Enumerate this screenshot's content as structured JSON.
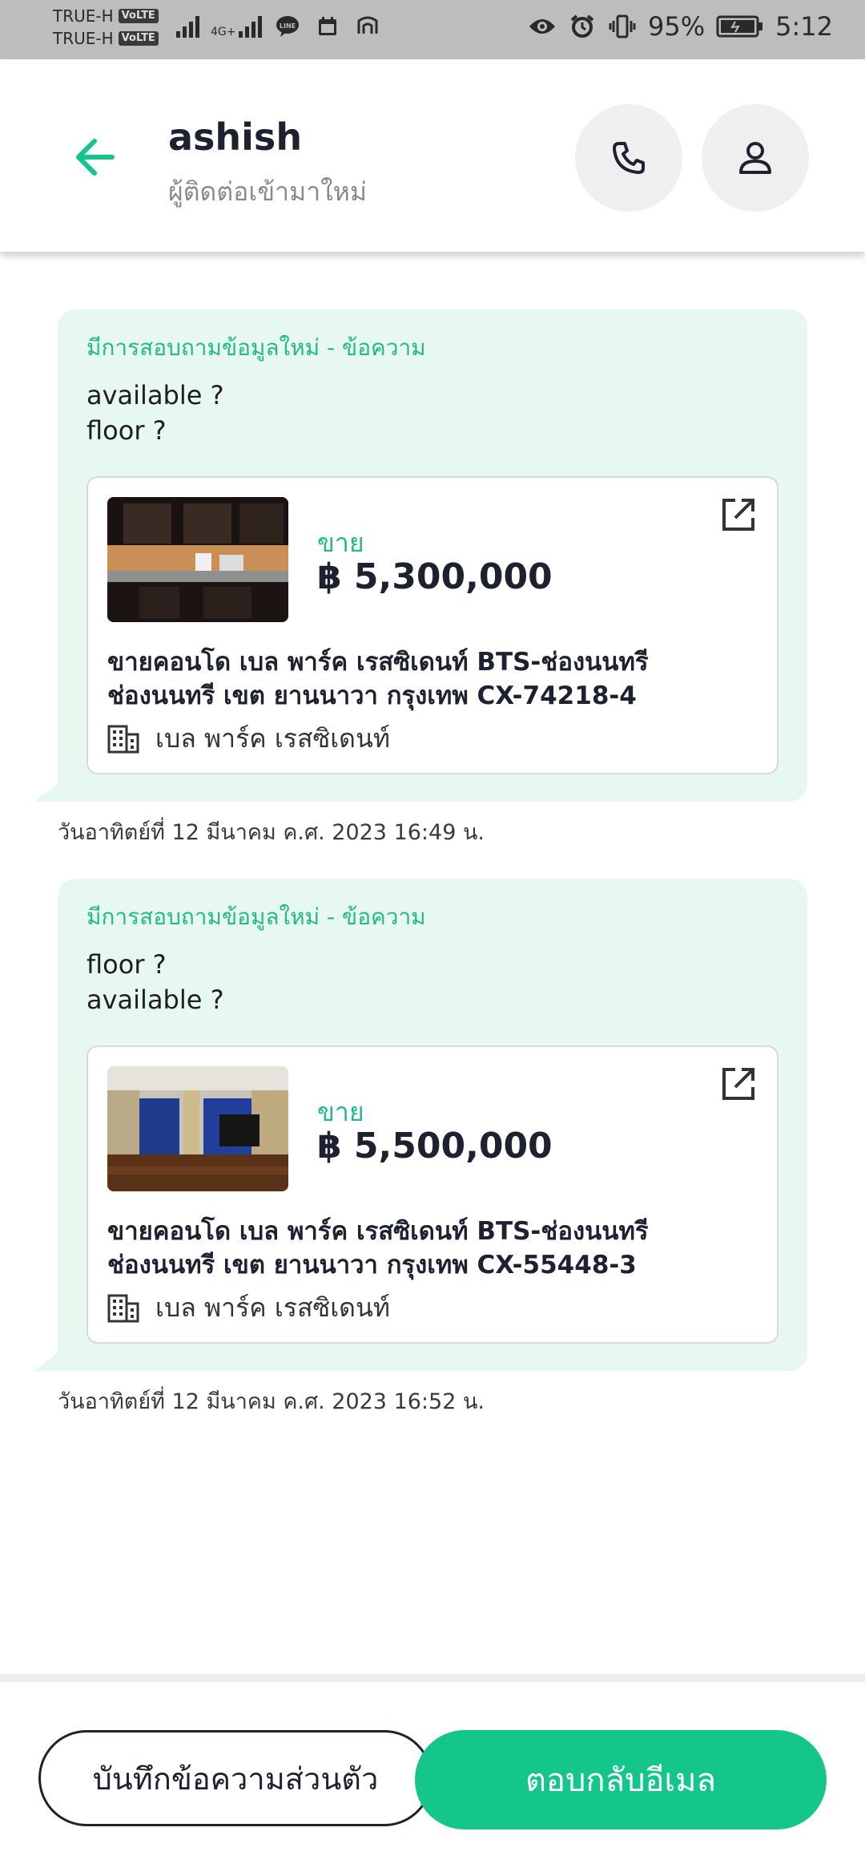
{
  "status_bar": {
    "carrier1": "TRUE-H",
    "carrier2": "TRUE-H",
    "volte": "VoLTE",
    "network": "4G+",
    "battery": "95%",
    "time": "5:12"
  },
  "header": {
    "name": "ashish",
    "subtitle": "ผู้ติดต่อเข้ามาใหม่"
  },
  "messages": [
    {
      "label": "มีการสอบถามข้อมูลใหม่ - ข้อความ",
      "lines": [
        "available ?",
        "floor ?"
      ],
      "listing": {
        "type": "ขาย",
        "price": "฿ 5,300,000",
        "title_line1": "ขายคอนโด  เบล พาร์ค เรสซิเดนท์ BTS-ช่องนนทรี",
        "title_line2": "ช่องนนทรี เขต ยานนาวา กรุงเทพ CX-74218-4",
        "project": "เบล พาร์ค เรสซิเดนท์"
      },
      "timestamp": "วันอาทิตย์ที่ 12 มีนาคม ค.ศ. 2023 16:49 น."
    },
    {
      "label": "มีการสอบถามข้อมูลใหม่ - ข้อความ",
      "lines": [
        "floor ?",
        "available ?"
      ],
      "listing": {
        "type": "ขาย",
        "price": "฿ 5,500,000",
        "title_line1": "ขายคอนโด  เบล พาร์ค เรสซิเดนท์ BTS-ช่องนนทรี",
        "title_line2": "ช่องนนทรี เขต ยานนาวา กรุงเทพ CX-55448-3",
        "project": "เบล พาร์ค เรสซิเดนท์"
      },
      "timestamp": "วันอาทิตย์ที่ 12 มีนาคม ค.ศ. 2023 16:52 น."
    }
  ],
  "actions": {
    "note_label": "บันทึกข้อความส่วนตัว",
    "reply_label": "ตอบกลับอีเมล"
  },
  "colors": {
    "accent": "#14c68a",
    "bubble": "#e7f8f1",
    "text_dark": "#1e2230"
  }
}
